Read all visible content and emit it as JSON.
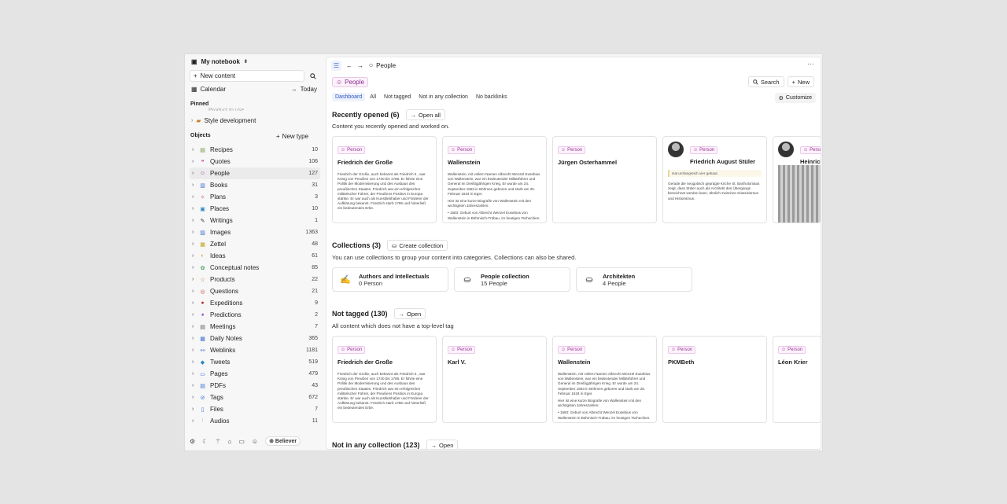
{
  "sidebar": {
    "notebook_title": "My notebook",
    "new_content": "New content",
    "calendar": "Calendar",
    "today": "Today",
    "pinned_label": "Pinned",
    "pinned_faded": "Product to use",
    "pinned_item": "Style development",
    "objects_label": "Objects",
    "new_type": "New type",
    "objects": [
      {
        "label": "Recipes",
        "count": "10",
        "icon": "recipe-icon",
        "glyph": "▤",
        "color": "#6a8f3a"
      },
      {
        "label": "Quotes",
        "count": "106",
        "icon": "quote-icon",
        "glyph": "❝",
        "color": "#b2418f"
      },
      {
        "label": "People",
        "count": "127",
        "icon": "person-icon",
        "glyph": "☺",
        "color": "#9b2f98"
      },
      {
        "label": "Books",
        "count": "31",
        "icon": "book-icon",
        "glyph": "▥",
        "color": "#3b6fd1"
      },
      {
        "label": "Plans",
        "count": "3",
        "icon": "plan-icon",
        "glyph": "✧",
        "color": "#c04a7a"
      },
      {
        "label": "Places",
        "count": "10",
        "icon": "place-icon",
        "glyph": "▣",
        "color": "#2c83c0"
      },
      {
        "label": "Writings",
        "count": "1",
        "icon": "writing-icon",
        "glyph": "✎",
        "color": "#333"
      },
      {
        "label": "Images",
        "count": "1363",
        "icon": "image-icon",
        "glyph": "▨",
        "color": "#3b6fd1"
      },
      {
        "label": "Zettel",
        "count": "48",
        "icon": "zettel-icon",
        "glyph": "▦",
        "color": "#c8a020"
      },
      {
        "label": "Ideas",
        "count": "61",
        "icon": "idea-icon",
        "glyph": "◐",
        "color": "#e0a020"
      },
      {
        "label": "Conceptual notes",
        "count": "85",
        "icon": "concept-icon",
        "glyph": "✿",
        "color": "#4a9a5a"
      },
      {
        "label": "Products",
        "count": "22",
        "icon": "product-icon",
        "glyph": "☆",
        "color": "#d2632a"
      },
      {
        "label": "Questions",
        "count": "21",
        "icon": "question-icon",
        "glyph": "◎",
        "color": "#d24a4a"
      },
      {
        "label": "Expeditions",
        "count": "9",
        "icon": "expedition-icon",
        "glyph": "●",
        "color": "#c43030"
      },
      {
        "label": "Predictions",
        "count": "2",
        "icon": "prediction-icon",
        "glyph": "◕",
        "color": "#8a3ac0"
      },
      {
        "label": "Meetings",
        "count": "7",
        "icon": "meeting-icon",
        "glyph": "▤",
        "color": "#555"
      },
      {
        "label": "Daily Notes",
        "count": "365",
        "icon": "daily-note-icon",
        "glyph": "▦",
        "color": "#3b6fd1"
      },
      {
        "label": "Weblinks",
        "count": "1181",
        "icon": "weblink-icon",
        "glyph": "⚯",
        "color": "#3b6fd1"
      },
      {
        "label": "Tweets",
        "count": "519",
        "icon": "tweet-icon",
        "glyph": "◆",
        "color": "#2c83c0"
      },
      {
        "label": "Pages",
        "count": "479",
        "icon": "page-icon",
        "glyph": "▭",
        "color": "#3b6fd1"
      },
      {
        "label": "PDFs",
        "count": "43",
        "icon": "pdf-icon",
        "glyph": "▤",
        "color": "#3b6fd1"
      },
      {
        "label": "Tags",
        "count": "672",
        "icon": "tag-icon",
        "glyph": "⊘",
        "color": "#3b6fd1"
      },
      {
        "label": "Files",
        "count": "7",
        "icon": "file-icon",
        "glyph": "▯",
        "color": "#3b6fd1"
      },
      {
        "label": "Audios",
        "count": "11",
        "icon": "audio-icon",
        "glyph": "⫶",
        "color": "#3b6fd1"
      }
    ],
    "believer": "Believer"
  },
  "main": {
    "breadcrumb": "People",
    "chip": "People",
    "search": "Search",
    "new": "New",
    "tabs": [
      "Dashboard",
      "All",
      "Not tagged",
      "Not in any collection",
      "No backlinks"
    ],
    "customize": "Customize",
    "recent": {
      "title": "Recently opened (6)",
      "action": "Open all",
      "sub": "Content you recently opened and worked on.",
      "cards": [
        {
          "tag": "Person",
          "title": "Friedrich der Große",
          "text": [
            "Friedrich der Große, auch bekannt als Friedrich II., war König von Preußen von 1740 bis 1786. Er führte eine Politik der Modernisierung und des Ausbaus des preußischen Staates. Friedrich war ein erfolgreicher militärischer Führer, der Preußens Position in Europa stärkte. Er war auch als Kunstliebhaber und Förderer der Aufklärung bekannt. Friedrich starb 1786 und hinterließ ein bedeutendes Erbe."
          ]
        },
        {
          "tag": "Person",
          "title": "Wallenstein",
          "text": [
            "Wallenstein, mit vollem Namen Albrecht Wenzel Eusebius von Wallenstein, war ein bedeutender Militärführer und General im Dreißigjährigen Krieg. Er wurde am 24. September 1583 in Böhmen geboren und starb am 25. Februar 1634 in Eger.",
            "Hier ist eine kurze Biografie von Wallenstein mit den wichtigsten Jahreszahlen:",
            "• 1583: Geburt von Albrecht Wenzel Eusebius von Wallenstein in Böhmisch-Trübau, im heutigen Tschechien."
          ]
        },
        {
          "tag": "Person",
          "title": "Jürgen Osterhammel",
          "text": []
        },
        {
          "tag": "Person",
          "title": "Friedrich August Stüler",
          "note": "Hat umfangreich vier gebaut.",
          "text": [
            "Gerade die neugotisch geprägte Kirche St. Bartholomäus zeigt, dass Stüler auch als Architekt des Übergangs bezeichnet werden kann, ähnlich zwischen Klassizismus und Historismus."
          ]
        },
        {
          "tag": "Person",
          "title": "Heinrich",
          "text": []
        }
      ]
    },
    "collections": {
      "title": "Collections (3)",
      "action": "Create collection",
      "sub": "You can use collections to group your content into categories. Collections can also be shared.",
      "items": [
        {
          "name": "Authors and Intellectuals",
          "count": "0 Person",
          "glyph": "✍"
        },
        {
          "name": "People collection",
          "count": "15 People",
          "glyph": "⛀"
        },
        {
          "name": "Architekten",
          "count": "4 People",
          "glyph": "⛀"
        }
      ]
    },
    "not_tagged": {
      "title": "Not tagged (130)",
      "action": "Open",
      "sub": "All content which does not have a top-level tag",
      "cards": [
        {
          "tag": "Person",
          "title": "Friedrich der Große",
          "text": [
            "Friedrich der Große, auch bekannt als Friedrich II., war König von Preußen von 1740 bis 1786. Er führte eine Politik der Modernisierung und des Ausbaus des preußischen Staates. Friedrich war ein erfolgreicher militärischer Führer, der Preußens Position in Europa stärkte. Er war auch als Kunstliebhaber und Förderer der Aufklärung bekannt. Friedrich starb 1786 und hinterließ ein bedeutendes Erbe."
          ]
        },
        {
          "tag": "Person",
          "title": "Karl V.",
          "text": []
        },
        {
          "tag": "Person",
          "title": "Wallenstein",
          "text": [
            "Wallenstein, mit vollem Namen Albrecht Wenzel Eusebius von Wallenstein, war ein bedeutender Militärführer und General im Dreißigjährigen Krieg. Er wurde am 24. September 1583 in Böhmen geboren und starb am 25. Februar 1634 in Eger.",
            "Hier ist eine kurze Biografie von Wallenstein mit den wichtigsten Jahreszahlen:",
            "• 1583: Geburt von Albrecht Wenzel Eusebius von Wallenstein in Böhmisch-Trübau, im heutigen Tschechien."
          ]
        },
        {
          "tag": "Person",
          "title": "PKMBeth",
          "text": []
        },
        {
          "tag": "Person",
          "title": "Léon Krier",
          "text": []
        }
      ]
    },
    "not_in_collection": {
      "title": "Not in any collection (123)",
      "action": "Open"
    }
  }
}
